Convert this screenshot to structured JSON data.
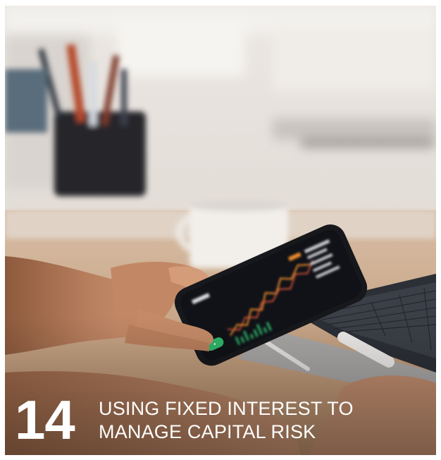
{
  "caption": {
    "number": "14",
    "title_line1": "USING FIXED INTEREST TO",
    "title_line2": "MANAGE CAPITAL RISK"
  },
  "scene": {
    "phone_button_label": "•",
    "colors": {
      "background": "#ebe7e2",
      "desk": "#c9a98b",
      "skin": "#b77e5d",
      "phone": "#1c1d22",
      "screen": "#14161c",
      "candle_up": "#2fb56a",
      "candle_down": "#e2583e",
      "accent_orange": "#e98a2b"
    }
  }
}
